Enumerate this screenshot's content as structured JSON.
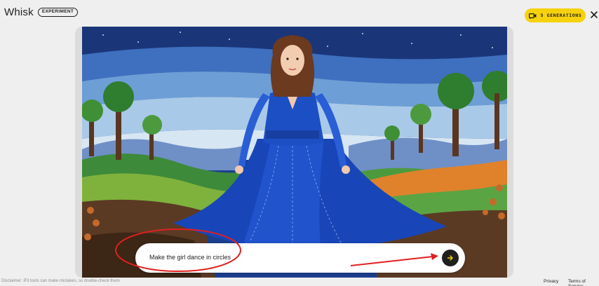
{
  "app": {
    "name": "Whisk",
    "badge": "EXPERIMENT"
  },
  "generations_button": {
    "label": "5 GENERATIONS",
    "icon": "video-camera-icon",
    "color": "#f6d20c"
  },
  "close_button": {
    "icon": "close-icon"
  },
  "image": {
    "subject": "woman in blue dress in felt landscape"
  },
  "prompt": {
    "value": "Make the girl dance in circles",
    "send_icon": "arrow-right-icon"
  },
  "annotations": {
    "color": "#e02020"
  },
  "footer": {
    "disclaimer": "Disclaimer: iFit tools can make mistakes, so double-check them",
    "links": [
      "Privacy",
      "Terms of Service"
    ]
  }
}
